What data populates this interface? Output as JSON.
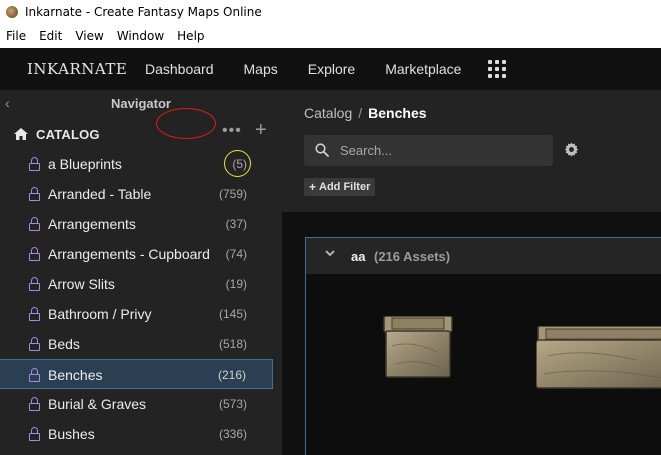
{
  "window": {
    "title": "Inkarnate - Create Fantasy Maps Online"
  },
  "menubar": {
    "items": [
      "File",
      "Edit",
      "View",
      "Window",
      "Help"
    ]
  },
  "navbar": {
    "logo": "INKARNATE",
    "links": [
      "Dashboard",
      "Maps",
      "Explore",
      "Marketplace"
    ]
  },
  "sidebar": {
    "title": "Navigator",
    "back_icon": "chevron-left-icon",
    "catalog_label": "CATALOG",
    "items": [
      {
        "label": "a Blueprints",
        "count": "(5)"
      },
      {
        "label": "Arranded - Table",
        "count": "(759)"
      },
      {
        "label": "Arrangements",
        "count": "(37)"
      },
      {
        "label": "Arrangements - Cupboard",
        "count": "(74)"
      },
      {
        "label": "Arrow Slits",
        "count": "(19)"
      },
      {
        "label": "Bathroom / Privy",
        "count": "(145)"
      },
      {
        "label": "Beds",
        "count": "(518)"
      },
      {
        "label": "Benches",
        "count": "(216)"
      },
      {
        "label": "Burial & Graves",
        "count": "(573)"
      },
      {
        "label": "Bushes",
        "count": "(336)"
      }
    ],
    "selected_index": 7
  },
  "main": {
    "breadcrumb": {
      "root": "Catalog",
      "separator": "/",
      "current": "Benches"
    },
    "search": {
      "placeholder": "Search..."
    },
    "add_filter_label": "Add Filter",
    "group": {
      "name": "aa",
      "count": "(216 Assets)"
    }
  },
  "colors": {
    "accent_blue": "#3c6e96",
    "lock_purple": "#a58be0",
    "annotation_red": "#e01b1b",
    "annotation_yellow": "#e6e633"
  }
}
